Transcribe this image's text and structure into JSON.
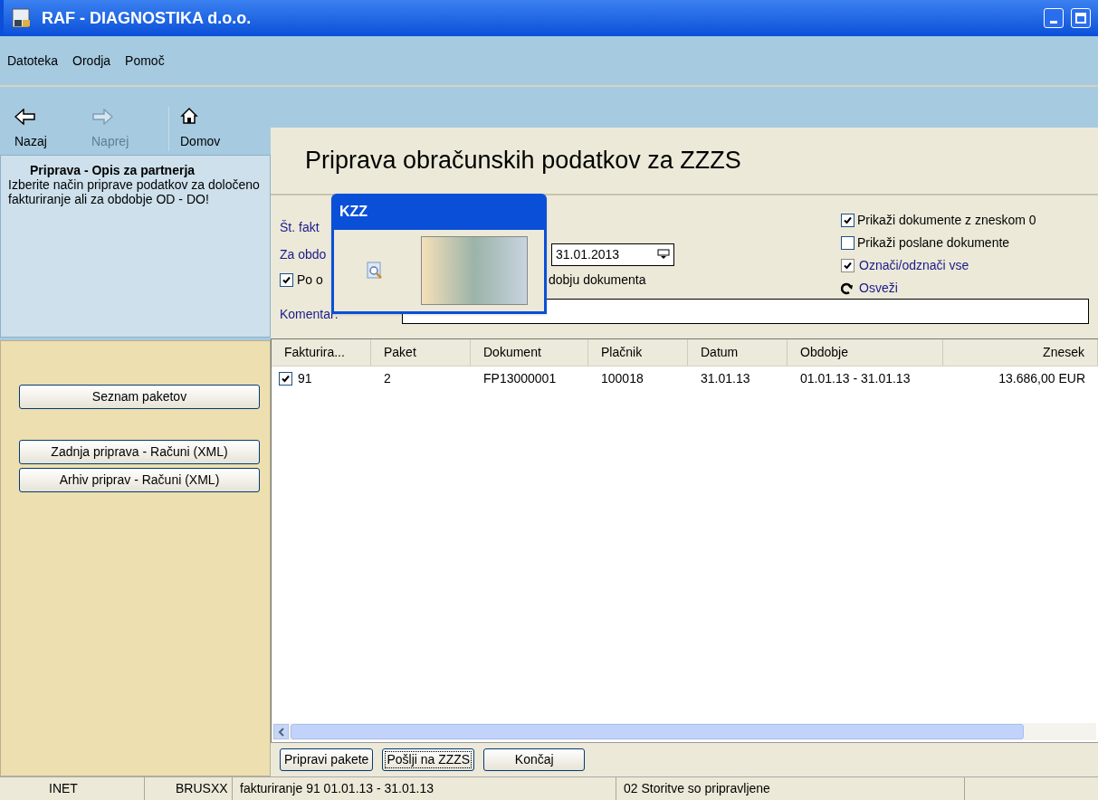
{
  "window": {
    "title": "RAF - DIAGNOSTIKA d.o.o."
  },
  "menu": [
    "Datoteka",
    "Orodja",
    "Pomoč"
  ],
  "toolbar": [
    {
      "kind": "back",
      "label": "Nazaj",
      "disabled": false
    },
    {
      "kind": "forward",
      "label": "Naprej",
      "disabled": true
    },
    {
      "kind": "home",
      "label": "Domov",
      "disabled": false
    }
  ],
  "description": {
    "title": "Priprava - Opis za partnerja",
    "text": "Izberite način priprave podatkov za določeno fakturiranje ali za obdobje OD - DO!"
  },
  "side_buttons": [
    "Seznam paketov",
    "Zadnja priprava - Računi (XML)",
    "Arhiv priprav - Računi (XML)"
  ],
  "page_title": "Priprava obračunskih podatkov za ZZZS",
  "form": {
    "invoice_label": "Št. fakt",
    "period_label": "Za obdo",
    "date_value": "31.01.2013",
    "by_period": {
      "label": "Po o",
      "checked": true
    },
    "by_period_tail": "dobju dokumenta",
    "comment_label": "Komentar:"
  },
  "options": [
    {
      "kind": "checkbox",
      "label": "Prikaži dokumente z zneskom 0",
      "checked": true
    },
    {
      "kind": "checkbox",
      "label": "Prikaži poslane dokumente",
      "checked": false
    },
    {
      "kind": "link-checkbox",
      "label": "Označi/odznači vse",
      "checked": true
    },
    {
      "kind": "refresh",
      "label": "Osveži"
    }
  ],
  "popup": {
    "title": "KZZ"
  },
  "table": {
    "columns": [
      "Fakturira...",
      "Paket",
      "Dokument",
      "Plačnik",
      "Datum",
      "Obdobje",
      "Znesek"
    ],
    "rows": [
      {
        "checked": true,
        "cells": [
          "91",
          "2",
          "FP13000001",
          "100018",
          "31.01.13",
          "01.01.13 - 31.01.13",
          "13.686,00 EUR"
        ]
      }
    ]
  },
  "buttons": [
    {
      "label": "Pripravi pakete",
      "focused": false
    },
    {
      "label": "Pošlji na ZZZS",
      "focused": true
    },
    {
      "label": "Končaj",
      "focused": false
    }
  ],
  "status_bar": [
    "INET",
    "BRUSXX",
    "fakturiranje 91  01.01.13 - 31.01.13",
    "02 Storitve so pripravljene"
  ]
}
